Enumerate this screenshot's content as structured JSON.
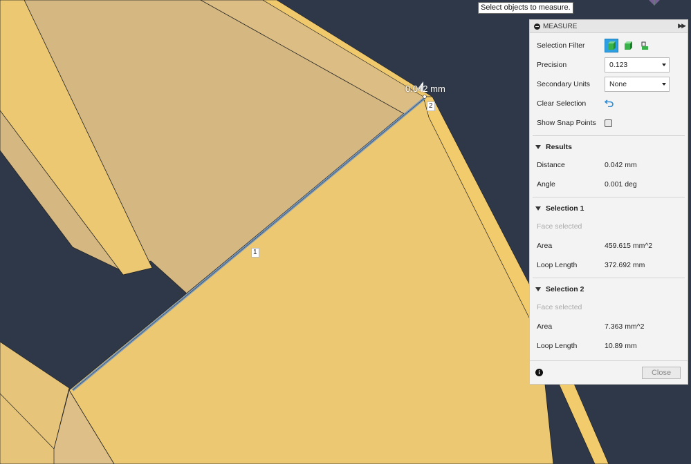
{
  "tooltip": "Select objects to measure.",
  "viewport": {
    "distance_label": "0.042 mm",
    "point_label_1": "1",
    "point_label_2": "2"
  },
  "panel": {
    "title": "MEASURE",
    "selection_filter_label": "Selection Filter",
    "selection_filter_icons": [
      "body-filter-icon",
      "face-filter-icon",
      "edge-filter-icon"
    ],
    "precision_label": "Precision",
    "precision_value": "0.123",
    "secondary_units_label": "Secondary Units",
    "secondary_units_value": "None",
    "clear_selection_label": "Clear Selection",
    "show_snap_points_label": "Show Snap Points",
    "show_snap_points_checked": false,
    "results": {
      "title": "Results",
      "distance_label": "Distance",
      "distance_value": "0.042 mm",
      "angle_label": "Angle",
      "angle_value": "0.001 deg"
    },
    "selection1": {
      "title": "Selection 1",
      "status": "Face selected",
      "area_label": "Area",
      "area_value": "459.615 mm^2",
      "loop_length_label": "Loop Length",
      "loop_length_value": "372.692 mm"
    },
    "selection2": {
      "title": "Selection 2",
      "status": "Face selected",
      "area_label": "Area",
      "area_value": "7.363 mm^2",
      "loop_length_label": "Loop Length",
      "loop_length_value": "10.89 mm"
    },
    "close_label": "Close"
  },
  "colors": {
    "background": "#2e3848",
    "face_light": "#ecc873",
    "face_dark": "#d4b781",
    "selected_edge": "#7d9bbb",
    "accent": "#2e9fe0"
  }
}
